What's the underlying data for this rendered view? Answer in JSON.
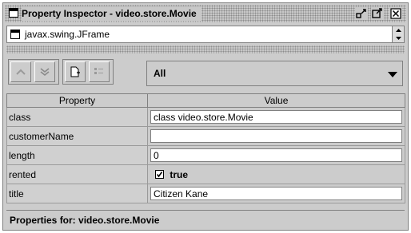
{
  "window": {
    "title": "Property Inspector - video.store.Movie",
    "icon": "window-icon",
    "controls": [
      "minimize-icon",
      "maximize-icon",
      "close-icon"
    ]
  },
  "target_selector": {
    "value": "javax.swing.JFrame",
    "icon": "frame-icon"
  },
  "toolbar": {
    "buttons": [
      "move-up-icon",
      "move-down-icon",
      "add-property-icon",
      "list-icon"
    ],
    "filter": {
      "selected": "All"
    }
  },
  "table": {
    "headers": {
      "property": "Property",
      "value": "Value"
    },
    "rows": [
      {
        "property": "class",
        "value": "class video.store.Movie",
        "type": "text"
      },
      {
        "property": "customerName",
        "value": "",
        "type": "text"
      },
      {
        "property": "length",
        "value": "0",
        "type": "text"
      },
      {
        "property": "rented",
        "value": "true",
        "type": "checkbox",
        "checked": true
      },
      {
        "property": "title",
        "value": "Citizen Kane",
        "type": "text"
      }
    ]
  },
  "footer": {
    "text": "Properties for:  video.store.Movie"
  }
}
